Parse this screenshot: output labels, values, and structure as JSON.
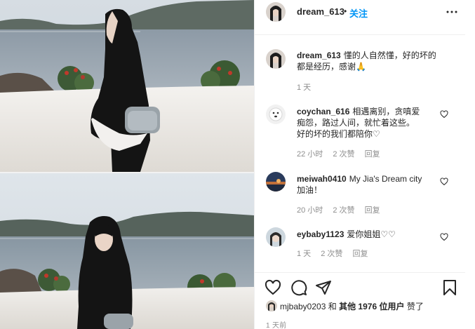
{
  "post": {
    "author": "dream_613",
    "dot": "•",
    "follow_label": "关注",
    "more_icon": "more-horizontal-icon"
  },
  "comments": [
    {
      "username": "dream_613",
      "text_line1": "懂的人自然懂，好的坏的",
      "text_line2": "都是经历，感谢🙏",
      "time": "1 天"
    },
    {
      "username": "coychan_616",
      "text_line1": "相遇离别，贪嗔爱",
      "text_line2": "痴怨，路过人间，就忙着这些。",
      "text_line3": "好的坏的我们都陪你♡",
      "time": "22 小时",
      "likes": "2 次赞",
      "reply": "回复"
    },
    {
      "username": "meiwah0410",
      "text_line1": "My Jia's Dream city",
      "text_line2": "加油！",
      "time": "20 小时",
      "likes": "2 次赞",
      "reply": "回复"
    },
    {
      "username": "eybaby1123",
      "text_line1": "爱你姐姐♡♡",
      "time": "1 天",
      "likes": "2 次赞",
      "reply": "回复"
    }
  ],
  "actions": {
    "like_icon": "heart-icon",
    "comment_icon": "comment-icon",
    "share_icon": "share-icon",
    "save_icon": "bookmark-icon"
  },
  "likes_summary": {
    "liker": "mjbaby0203",
    "and": "和",
    "others": "其他 1976 位用户",
    "liked": "赞了"
  },
  "timestamp": "1 天前"
}
